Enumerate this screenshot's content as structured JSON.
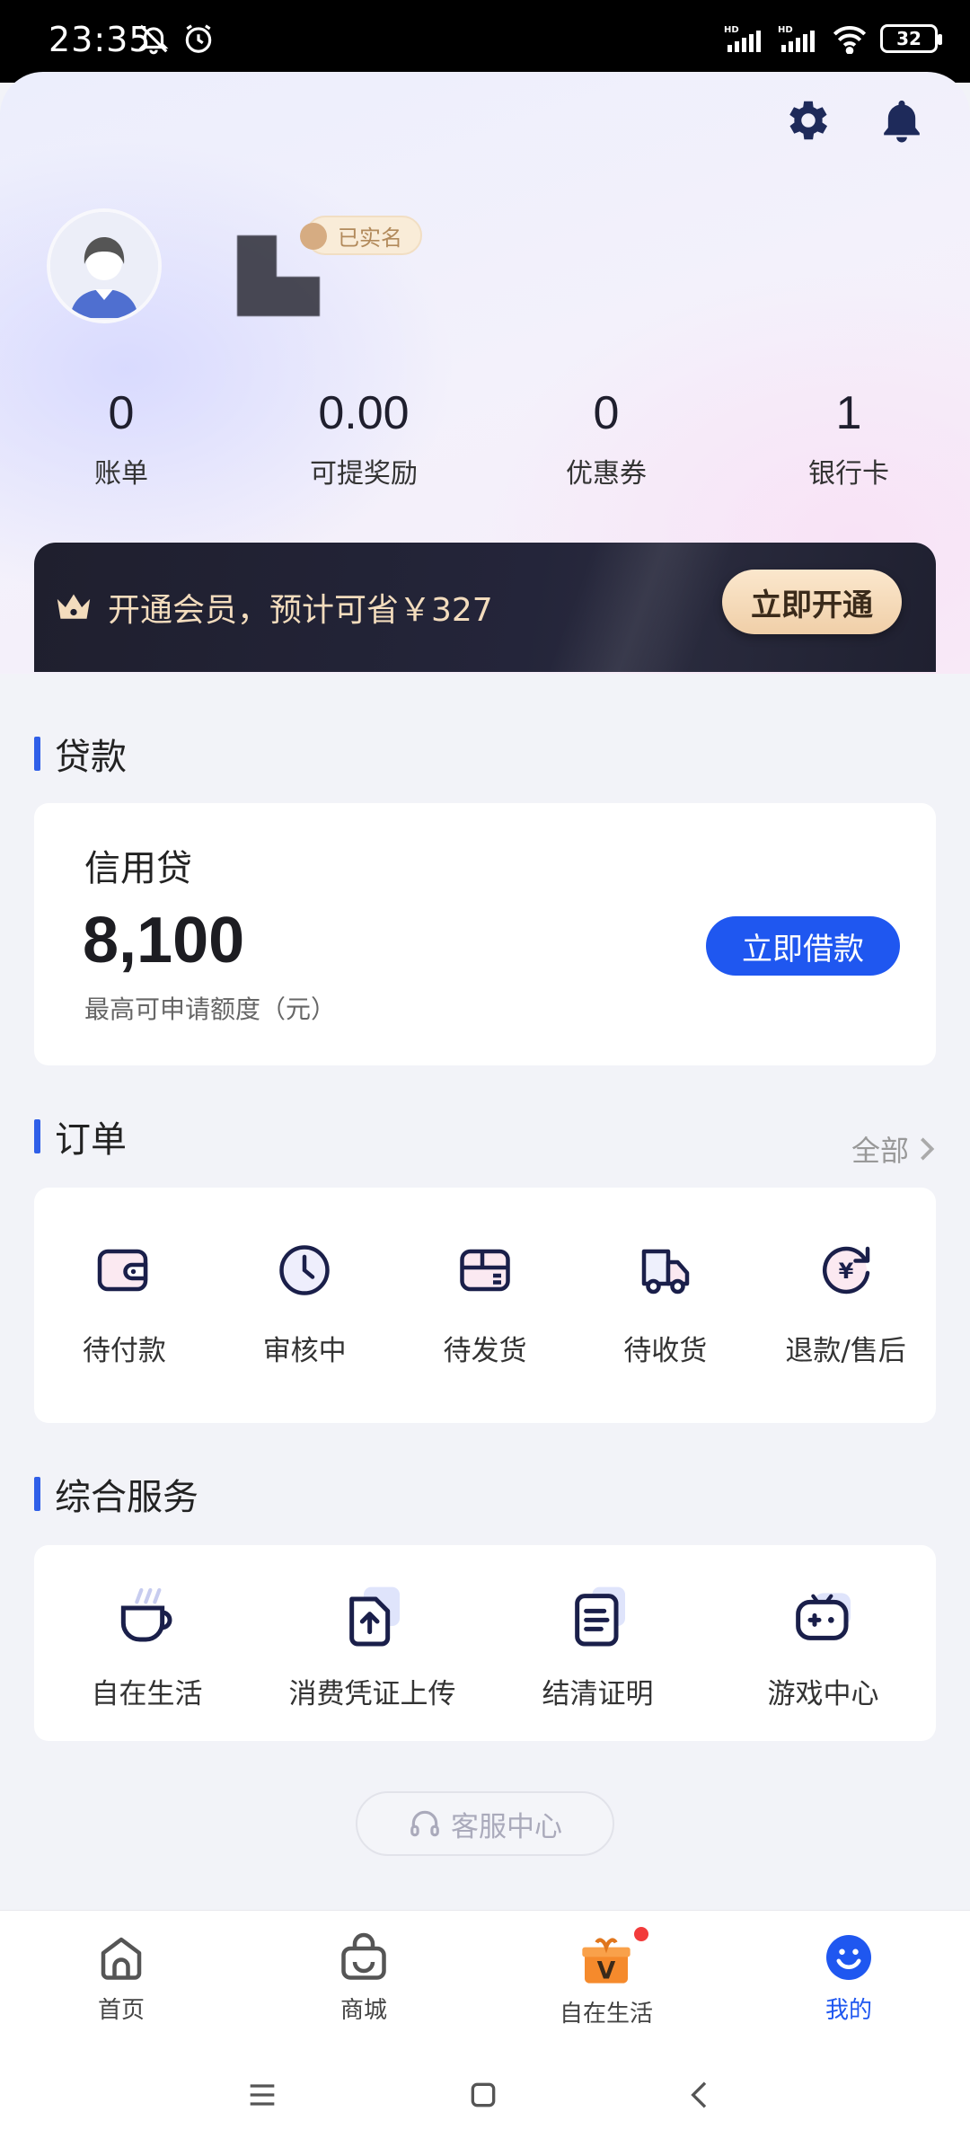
{
  "status_bar": {
    "time": "23:35",
    "battery": "32",
    "left_icons": [
      "bell-muted-icon",
      "alarm-icon"
    ],
    "right_icons": [
      "hd-signal-icon",
      "hd-signal-icon",
      "wifi-icon",
      "battery-icon"
    ]
  },
  "header": {
    "settings_icon": "gear-icon",
    "bell_icon": "bell-icon",
    "verify_badge": "已实名"
  },
  "stats": [
    {
      "value": "0",
      "label": "账单"
    },
    {
      "value": "0.00",
      "label": "可提奖励"
    },
    {
      "value": "0",
      "label": "优惠券"
    },
    {
      "value": "1",
      "label": "银行卡"
    }
  ],
  "vip": {
    "text": "开通会员，预计可省￥327",
    "button": "立即开通"
  },
  "loan": {
    "section_title": "贷款",
    "name": "信用贷",
    "amount": "8,100",
    "desc": "最高可申请额度（元）",
    "button": "立即借款"
  },
  "orders": {
    "section_title": "订单",
    "all_link": "全部",
    "items": [
      {
        "label": "待付款",
        "icon": "wallet-icon"
      },
      {
        "label": "审核中",
        "icon": "clock-icon"
      },
      {
        "label": "待发货",
        "icon": "package-icon"
      },
      {
        "label": "待收货",
        "icon": "truck-icon"
      },
      {
        "label": "退款/售后",
        "icon": "refund-icon"
      }
    ]
  },
  "services": {
    "section_title": "综合服务",
    "items": [
      {
        "label": "自在生活",
        "icon": "cup-icon"
      },
      {
        "label": "消费凭证上传",
        "icon": "upload-icon"
      },
      {
        "label": "结清证明",
        "icon": "document-icon"
      },
      {
        "label": "游戏中心",
        "icon": "gamepad-icon"
      }
    ]
  },
  "customer_service": "客服中心",
  "bottom_nav": [
    {
      "label": "首页",
      "icon": "home-icon",
      "active": false
    },
    {
      "label": "商城",
      "icon": "shopping-bag-icon",
      "active": false
    },
    {
      "label": "自在生活",
      "icon": "gift-icon",
      "active": false
    },
    {
      "label": "我的",
      "icon": "smiley-icon",
      "active": true
    }
  ],
  "colors": {
    "accent": "#1f57f0",
    "vip_bg": "#1f1f2e",
    "vip_gold": "#f3dcbd"
  }
}
